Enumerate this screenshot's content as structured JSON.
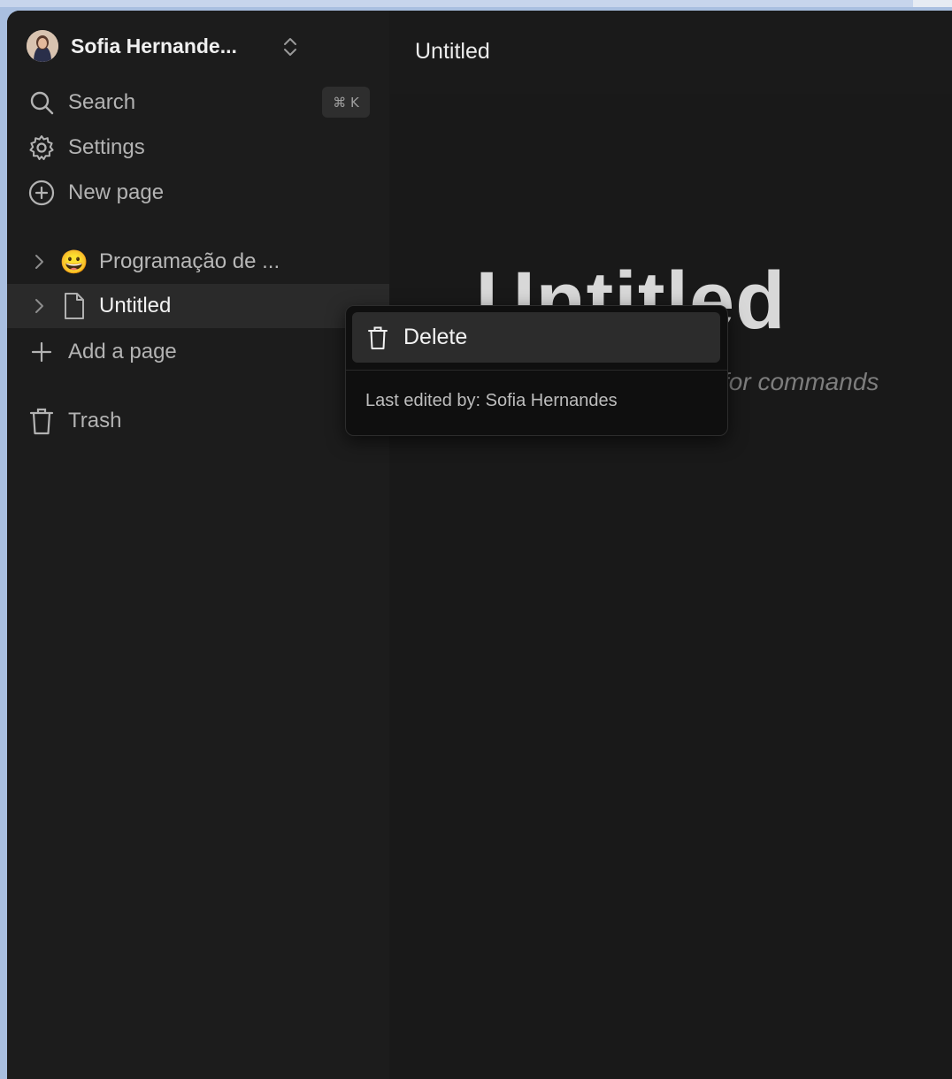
{
  "workspace": {
    "name": "Sofia Hernande...",
    "avatar_icon": "user-avatar"
  },
  "nav": {
    "search_label": "Search",
    "search_shortcut": "⌘ K",
    "settings_label": "Settings",
    "new_page_label": "New page"
  },
  "tree": [
    {
      "emoji": "😀",
      "label": "Programação de ..."
    },
    {
      "emoji": "",
      "label": "Untitled"
    }
  ],
  "add_page_label": "Add a page",
  "trash_label": "Trash",
  "header": {
    "title": "Untitled"
  },
  "editor": {
    "title": "Untitled",
    "placeholder_hint": "for commands"
  },
  "context_menu": {
    "delete_label": "Delete",
    "last_edited": "Last edited by: Sofia Hernandes"
  },
  "colors": {
    "background": "#191919",
    "sidebar": "#1c1c1c",
    "menu": "#0f0f0f",
    "accent_text": "#f2f2f2"
  }
}
